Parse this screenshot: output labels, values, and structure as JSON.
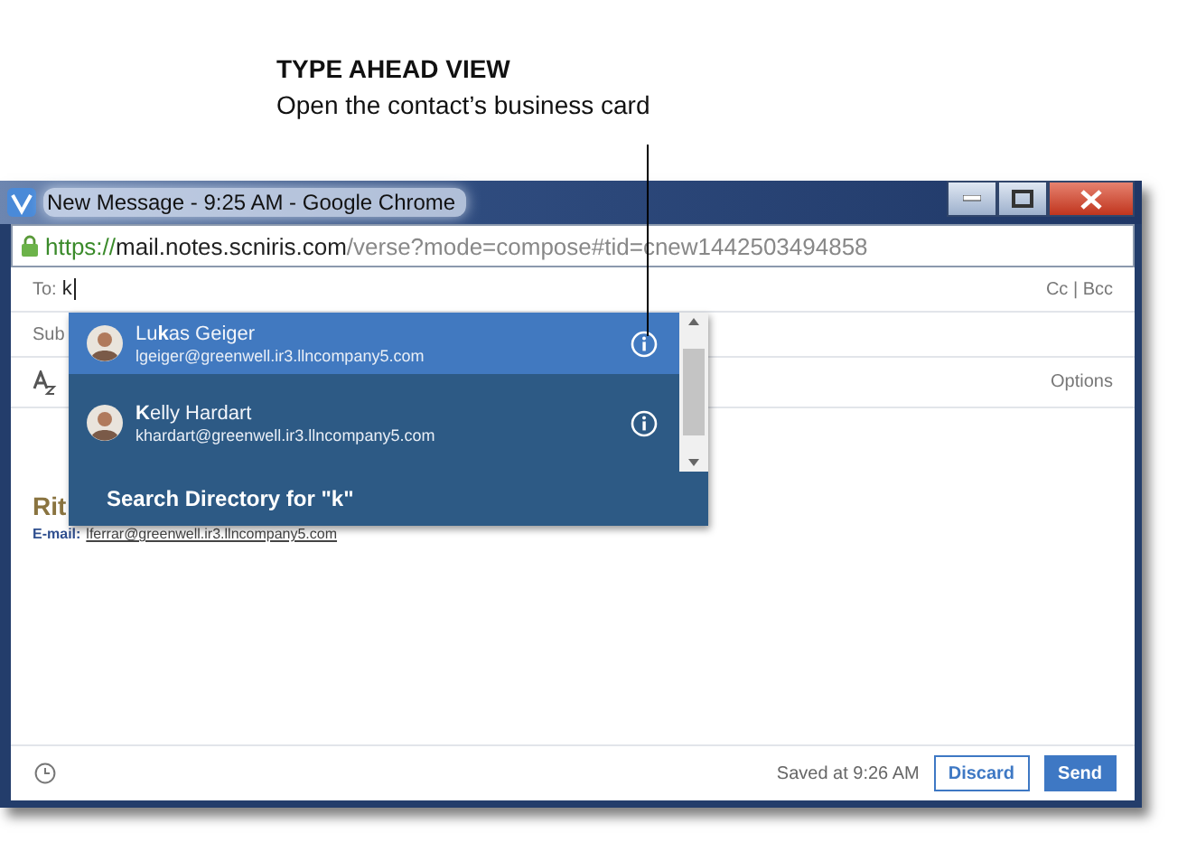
{
  "annotation": {
    "title": "TYPE AHEAD VIEW",
    "text": "Open the contact’s business card"
  },
  "window": {
    "title": "New Message - 9:25 AM - Google Chrome"
  },
  "address_bar": {
    "scheme": "https://",
    "host": "mail.notes.scniris.com",
    "path": "/verse?mode=compose#tid=cnew1442503494858"
  },
  "to_field": {
    "label": "To:",
    "value": "k",
    "cc_bcc": "Cc | Bcc"
  },
  "subject_field": {
    "label": "Sub"
  },
  "toolbar": {
    "options": "Options"
  },
  "body": {
    "heading": "Rit",
    "email_label": "E-mail:",
    "email_link": "lferrar@greenwell.ir3.llncompany5.com"
  },
  "suggestions": [
    {
      "name": "Lu**k**as Geiger",
      "email": "lgeiger@greenwell.ir3.llncompany5.com",
      "selected": true
    },
    {
      "name": "**K**elly Hardart",
      "email": "khardart@greenwell.ir3.llncompany5.com",
      "selected": false
    }
  ],
  "search_directory": "Search Directory for \"k\"",
  "footer": {
    "saved": "Saved at 9:26 AM",
    "discard": "Discard",
    "send": "Send"
  }
}
